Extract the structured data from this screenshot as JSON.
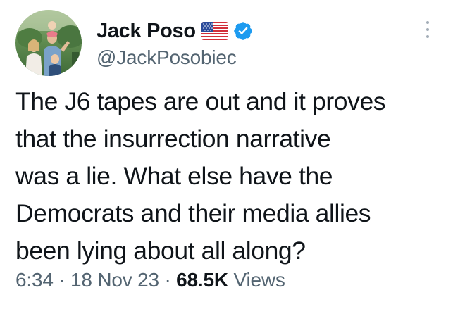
{
  "author": {
    "display_name": "Jack Poso",
    "handle": "@JackPosobiec",
    "flag_icon": "us-flag-icon",
    "verified_icon": "verified-badge-icon",
    "avatar_icon": "profile-photo"
  },
  "tweet": {
    "text_lines": [
      "The J6 tapes are out and it proves",
      "that the insurrection narrative",
      "was a lie. What else have the",
      "Democrats and their media allies",
      "been lying about all along?"
    ]
  },
  "meta": {
    "time": "6:34",
    "separator": "·",
    "date": "18 Nov 23",
    "views_count": "68.5K",
    "views_label": "Views"
  },
  "colors": {
    "text_primary": "#0f1419",
    "text_secondary": "#536471",
    "verified_blue": "#1d9bf0"
  }
}
